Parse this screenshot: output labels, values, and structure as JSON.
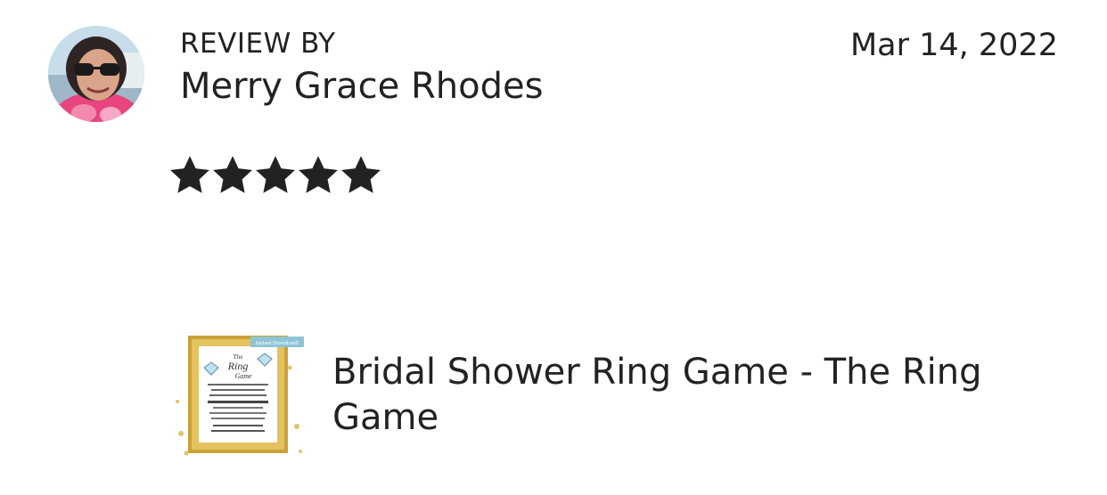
{
  "review": {
    "header_label": "REVIEW BY",
    "reviewer_name": "Merry Grace Rhodes",
    "date": "Mar 14, 2022",
    "rating": 5,
    "rating_max": 5
  },
  "product": {
    "title": "Bridal Shower Ring Game - The Ring Game",
    "thumbnail": {
      "banner": "Instant Download!",
      "heading_line1": "The",
      "heading_line2": "Ring",
      "heading_line3": "Game"
    }
  },
  "icons": {
    "star": "star-icon"
  },
  "colors": {
    "text": "#222222",
    "star": "#222222",
    "frame_gold": "#c9a23a",
    "banner": "#8ec5d6"
  }
}
